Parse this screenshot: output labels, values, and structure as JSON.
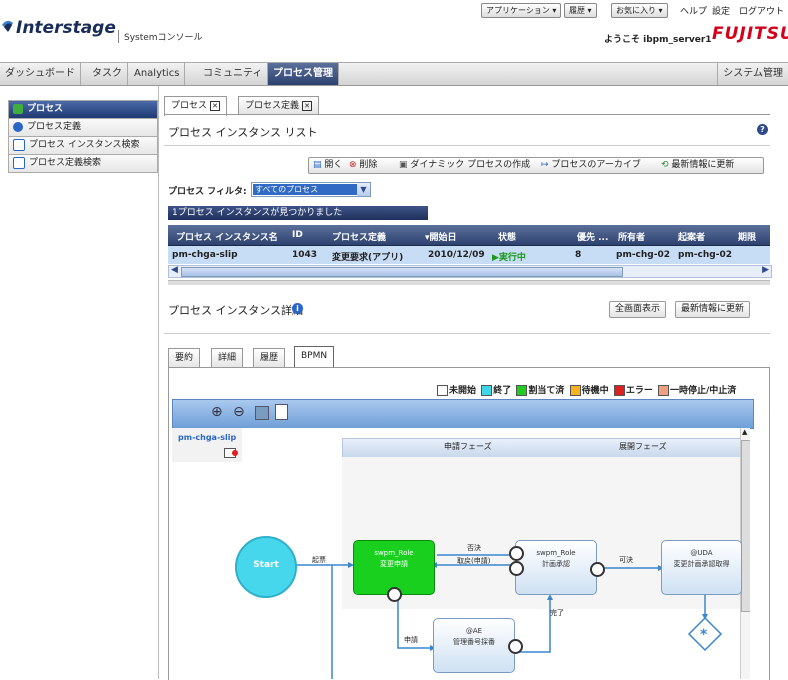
{
  "header": {
    "top_buttons": [
      "アプリケーション ▾",
      "履歴 ▾",
      "お気に入り ▾"
    ],
    "links": [
      "ヘルプ",
      "設定",
      "ログアウト"
    ],
    "logo": "Interstage",
    "logo_sub": "Systemコンソール",
    "welcome": "ようこそ ibpm_server1",
    "brand": "FUJITSU"
  },
  "nav": {
    "items": [
      "ダッシュボード",
      "タスク",
      "Analytics",
      "コミュニティ",
      "プロセス管理"
    ],
    "right": "システム管理"
  },
  "sidebar": {
    "items": [
      "プロセス",
      "プロセス定義",
      "プロセス インスタンス検索",
      "プロセス定義検索"
    ]
  },
  "main": {
    "tabs": [
      "プロセス",
      "プロセス定義"
    ],
    "list_title": "プロセス インスタンス リスト",
    "toolbar": [
      "開く",
      "削除",
      "ダイナミック プロセスの作成",
      "プロセスのアーカイブ",
      "最新情報に更新"
    ],
    "filter_label": "プロセス フィルタ:",
    "filter_value": "すべてのプロセス",
    "found_text": "1プロセス インスタンスが見つかりました",
    "columns": [
      "プロセス インスタンス名",
      "ID",
      "プロセス定義",
      "▾開始日",
      "状態",
      "優先 ...",
      "所有者",
      "起案者",
      "期限"
    ],
    "rows": [
      [
        "pm-chga-slip",
        "1043",
        "変更要求(アプリ)",
        "2010/12/09",
        "▶実行中",
        "8",
        "pm-chg-02",
        "pm-chg-02",
        ""
      ]
    ],
    "detail_title": "プロセス インスタンス詳細",
    "detail_buttons": [
      "全画面表示",
      "最新情報に更新"
    ],
    "subtabs": [
      "要約",
      "詳細",
      "履歴",
      "BPMN"
    ]
  },
  "legend": [
    {
      "label": "未開始",
      "color": "#ffffff"
    },
    {
      "label": "終了",
      "color": "#3fd7e8"
    },
    {
      "label": "割当て済",
      "color": "#1fcd1f"
    },
    {
      "label": "待機中",
      "color": "#f7b21e"
    },
    {
      "label": "エラー",
      "color": "#e0201f"
    },
    {
      "label": "一時停止/中止済",
      "color": "#f0a080"
    }
  ],
  "bpmn": {
    "instance": "pm-chga-slip",
    "lanes": [
      "申請フェーズ",
      "展開フェーズ"
    ],
    "start": "Start",
    "nodes": [
      {
        "role": "swpm_Role",
        "name": "変更申請"
      },
      {
        "role": "swpm_Role",
        "name": "計画承認"
      },
      {
        "role": "@UDA",
        "name": "変更計画承認取得"
      },
      {
        "role": "@AE",
        "name": "管理番号採番"
      }
    ],
    "edges": [
      "起票",
      "否決",
      "取戻(申請)",
      "可決",
      "申請",
      "完了"
    ]
  }
}
